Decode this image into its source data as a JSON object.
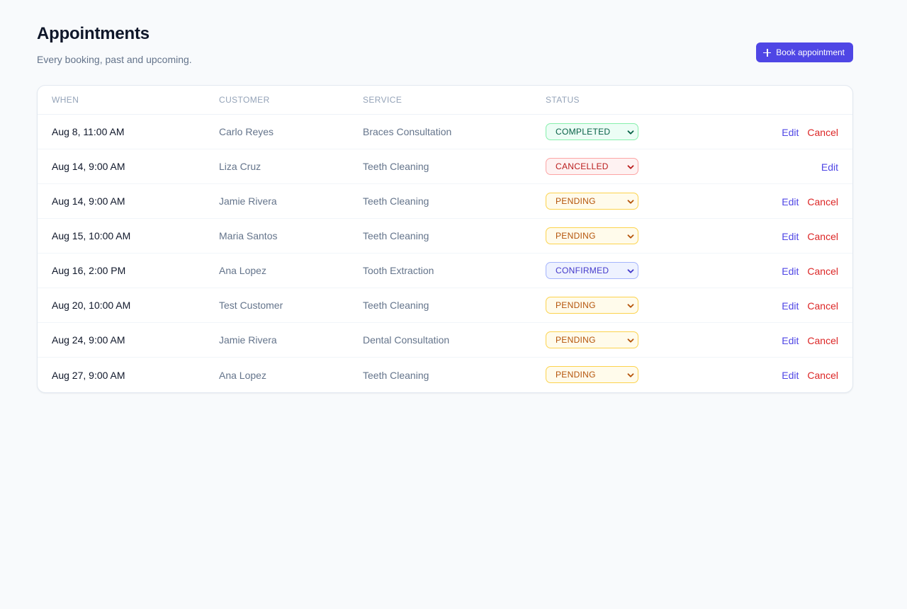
{
  "header": {
    "title": "Appointments",
    "subtitle": "Every booking, past and upcoming.",
    "book_button_label": "Book appointment"
  },
  "table": {
    "columns": [
      "WHEN",
      "CUSTOMER",
      "SERVICE",
      "STATUS"
    ],
    "rows": [
      {
        "when": "Aug 8, 11:00 AM",
        "customer": "Carlo Reyes",
        "service": "Braces Consultation",
        "status": "COMPLETED",
        "status_key": "completed",
        "edit": "Edit",
        "cancel": "Cancel"
      },
      {
        "when": "Aug 14, 9:00 AM",
        "customer": "Liza Cruz",
        "service": "Teeth Cleaning",
        "status": "CANCELLED",
        "status_key": "cancelled",
        "edit": "Edit",
        "cancel": ""
      },
      {
        "when": "Aug 14, 9:00 AM",
        "customer": "Jamie Rivera",
        "service": "Teeth Cleaning",
        "status": "PENDING",
        "status_key": "pending",
        "edit": "Edit",
        "cancel": "Cancel"
      },
      {
        "when": "Aug 15, 10:00 AM",
        "customer": "Maria Santos",
        "service": "Teeth Cleaning",
        "status": "PENDING",
        "status_key": "pending",
        "edit": "Edit",
        "cancel": "Cancel"
      },
      {
        "when": "Aug 16, 2:00 PM",
        "customer": "Ana Lopez",
        "service": "Tooth Extraction",
        "status": "CONFIRMED",
        "status_key": "confirmed",
        "edit": "Edit",
        "cancel": "Cancel"
      },
      {
        "when": "Aug 20, 10:00 AM",
        "customer": "Test Customer",
        "service": "Teeth Cleaning",
        "status": "PENDING",
        "status_key": "pending",
        "edit": "Edit",
        "cancel": "Cancel"
      },
      {
        "when": "Aug 24, 9:00 AM",
        "customer": "Jamie Rivera",
        "service": "Dental Consultation",
        "status": "PENDING",
        "status_key": "pending",
        "edit": "Edit",
        "cancel": "Cancel"
      },
      {
        "when": "Aug 27, 9:00 AM",
        "customer": "Ana Lopez",
        "service": "Teeth Cleaning",
        "status": "PENDING",
        "status_key": "pending",
        "edit": "Edit",
        "cancel": "Cancel"
      }
    ]
  },
  "colors": {
    "accent": "#4f46e5",
    "danger": "#dc2626",
    "completed": "#065f46",
    "cancelled": "#b91c1c",
    "pending": "#b45309",
    "confirmed": "#4338ca"
  },
  "icons": {
    "book_button": "plus-icon",
    "status_select": "chevron-down-icon"
  }
}
